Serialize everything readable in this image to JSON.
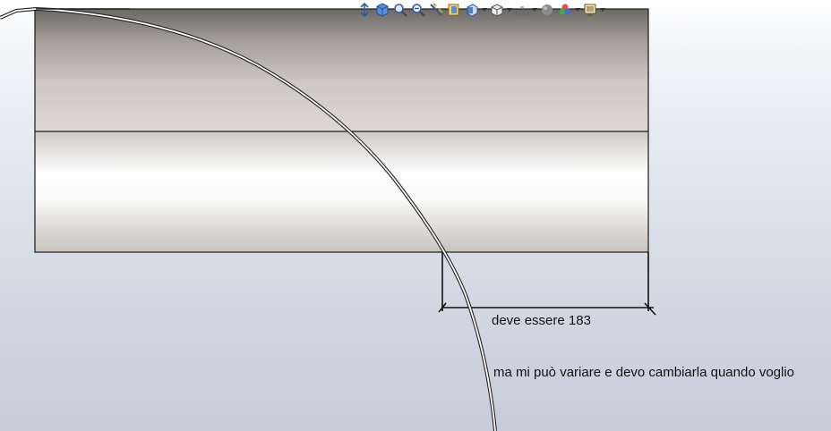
{
  "toolbar": {
    "buttons": [
      {
        "icon": "zoom-to-fit-icon"
      },
      {
        "icon": "view-cube-icon"
      },
      {
        "icon": "zoom-to-area-icon"
      },
      {
        "icon": "previous-view-icon"
      },
      {
        "icon": "section-view-icon"
      },
      {
        "icon": "dynamic-annotation-icon"
      },
      {
        "icon": "view-orientation-icon",
        "dropdown": true
      },
      {
        "icon": "display-style-icon",
        "dropdown": true
      },
      {
        "icon": "hide-show-items-icon",
        "dropdown": true
      },
      {
        "icon": "edit-appearance-icon"
      },
      {
        "icon": "apply-scene-icon",
        "dropdown": true
      },
      {
        "icon": "view-settings-icon",
        "dropdown": true
      }
    ]
  },
  "annotations": {
    "dimension_note": "deve essere 183",
    "hint_note": "ma mi può variare e devo cambiarla quando voglio"
  },
  "colors": {
    "background_top": "#ffffff",
    "background_bottom": "#c6cdd9",
    "model_edge": "#1a1a1a",
    "arc_stroke": "#222222"
  }
}
